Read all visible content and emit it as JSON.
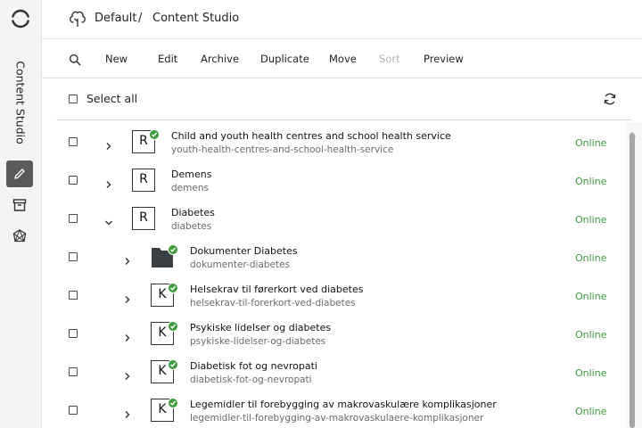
{
  "rail": {
    "app_label": "Content Studio",
    "items": [
      {
        "name": "edit",
        "icon": "pencil-icon",
        "active": true
      },
      {
        "name": "archive",
        "icon": "archive-box-icon",
        "active": false
      },
      {
        "name": "graph",
        "icon": "graph-network-icon",
        "active": false
      }
    ]
  },
  "header": {
    "project": "Default",
    "separator": "/",
    "app": "Content Studio"
  },
  "toolbar": {
    "new": "New",
    "edit": "Edit",
    "archive": "Archive",
    "duplicate": "Duplicate",
    "move": "Move",
    "sort": "Sort",
    "preview": "Preview"
  },
  "selection": {
    "select_all": "Select all"
  },
  "colors": {
    "online": "#3e9b3e",
    "rail_bg": "#f4f4f4",
    "active_rail": "#5a5a5a",
    "disabled": "#b3b3b3"
  },
  "rows": [
    {
      "name": "Child and youth health centres and school health service",
      "path": "youth-health-centres-and-school-health-service",
      "status": "Online",
      "icon": "R",
      "type": "page",
      "level": 0,
      "expanded": false,
      "published": true
    },
    {
      "name": "Demens",
      "path": "demens",
      "status": "Online",
      "icon": "R",
      "type": "page",
      "level": 0,
      "expanded": false,
      "published": false
    },
    {
      "name": "Diabetes",
      "path": "diabetes",
      "status": "Online",
      "icon": "R",
      "type": "page",
      "level": 0,
      "expanded": true,
      "published": false
    },
    {
      "name": "Dokumenter Diabetes",
      "path": "dokumenter-diabetes",
      "status": "Online",
      "icon": "folder",
      "type": "folder",
      "level": 1,
      "expanded": false,
      "published": true
    },
    {
      "name": "Helsekrav til førerkort ved diabetes",
      "path": "helsekrav-til-forerkort-ved-diabetes",
      "status": "Online",
      "icon": "K",
      "type": "page",
      "level": 1,
      "expanded": false,
      "published": true
    },
    {
      "name": "Psykiske lidelser og diabetes",
      "path": "psykiske-lidelser-og-diabetes",
      "status": "Online",
      "icon": "K",
      "type": "page",
      "level": 1,
      "expanded": false,
      "published": true
    },
    {
      "name": "Diabetisk fot og nevropati",
      "path": "diabetisk-fot-og-nevropati",
      "status": "Online",
      "icon": "K",
      "type": "page",
      "level": 1,
      "expanded": false,
      "published": true
    },
    {
      "name": "Legemidler til forebygging av makrovaskulære komplikasjoner",
      "path": "legemidler-til-forebygging-av-makrovaskulaere-komplikasjoner",
      "status": "Online",
      "icon": "K",
      "type": "page",
      "level": 1,
      "expanded": false,
      "published": true
    }
  ]
}
